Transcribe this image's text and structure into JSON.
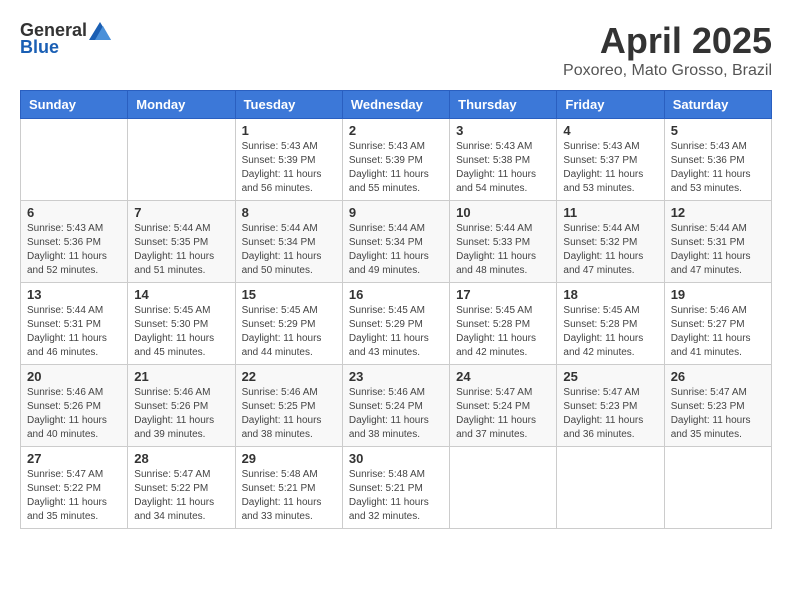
{
  "header": {
    "logo_general": "General",
    "logo_blue": "Blue",
    "title": "April 2025",
    "subtitle": "Poxoreo, Mato Grosso, Brazil"
  },
  "calendar": {
    "headers": [
      "Sunday",
      "Monday",
      "Tuesday",
      "Wednesday",
      "Thursday",
      "Friday",
      "Saturday"
    ],
    "weeks": [
      [
        {
          "day": "",
          "info": ""
        },
        {
          "day": "",
          "info": ""
        },
        {
          "day": "1",
          "info": "Sunrise: 5:43 AM\nSunset: 5:39 PM\nDaylight: 11 hours and 56 minutes."
        },
        {
          "day": "2",
          "info": "Sunrise: 5:43 AM\nSunset: 5:39 PM\nDaylight: 11 hours and 55 minutes."
        },
        {
          "day": "3",
          "info": "Sunrise: 5:43 AM\nSunset: 5:38 PM\nDaylight: 11 hours and 54 minutes."
        },
        {
          "day": "4",
          "info": "Sunrise: 5:43 AM\nSunset: 5:37 PM\nDaylight: 11 hours and 53 minutes."
        },
        {
          "day": "5",
          "info": "Sunrise: 5:43 AM\nSunset: 5:36 PM\nDaylight: 11 hours and 53 minutes."
        }
      ],
      [
        {
          "day": "6",
          "info": "Sunrise: 5:43 AM\nSunset: 5:36 PM\nDaylight: 11 hours and 52 minutes."
        },
        {
          "day": "7",
          "info": "Sunrise: 5:44 AM\nSunset: 5:35 PM\nDaylight: 11 hours and 51 minutes."
        },
        {
          "day": "8",
          "info": "Sunrise: 5:44 AM\nSunset: 5:34 PM\nDaylight: 11 hours and 50 minutes."
        },
        {
          "day": "9",
          "info": "Sunrise: 5:44 AM\nSunset: 5:34 PM\nDaylight: 11 hours and 49 minutes."
        },
        {
          "day": "10",
          "info": "Sunrise: 5:44 AM\nSunset: 5:33 PM\nDaylight: 11 hours and 48 minutes."
        },
        {
          "day": "11",
          "info": "Sunrise: 5:44 AM\nSunset: 5:32 PM\nDaylight: 11 hours and 47 minutes."
        },
        {
          "day": "12",
          "info": "Sunrise: 5:44 AM\nSunset: 5:31 PM\nDaylight: 11 hours and 47 minutes."
        }
      ],
      [
        {
          "day": "13",
          "info": "Sunrise: 5:44 AM\nSunset: 5:31 PM\nDaylight: 11 hours and 46 minutes."
        },
        {
          "day": "14",
          "info": "Sunrise: 5:45 AM\nSunset: 5:30 PM\nDaylight: 11 hours and 45 minutes."
        },
        {
          "day": "15",
          "info": "Sunrise: 5:45 AM\nSunset: 5:29 PM\nDaylight: 11 hours and 44 minutes."
        },
        {
          "day": "16",
          "info": "Sunrise: 5:45 AM\nSunset: 5:29 PM\nDaylight: 11 hours and 43 minutes."
        },
        {
          "day": "17",
          "info": "Sunrise: 5:45 AM\nSunset: 5:28 PM\nDaylight: 11 hours and 42 minutes."
        },
        {
          "day": "18",
          "info": "Sunrise: 5:45 AM\nSunset: 5:28 PM\nDaylight: 11 hours and 42 minutes."
        },
        {
          "day": "19",
          "info": "Sunrise: 5:46 AM\nSunset: 5:27 PM\nDaylight: 11 hours and 41 minutes."
        }
      ],
      [
        {
          "day": "20",
          "info": "Sunrise: 5:46 AM\nSunset: 5:26 PM\nDaylight: 11 hours and 40 minutes."
        },
        {
          "day": "21",
          "info": "Sunrise: 5:46 AM\nSunset: 5:26 PM\nDaylight: 11 hours and 39 minutes."
        },
        {
          "day": "22",
          "info": "Sunrise: 5:46 AM\nSunset: 5:25 PM\nDaylight: 11 hours and 38 minutes."
        },
        {
          "day": "23",
          "info": "Sunrise: 5:46 AM\nSunset: 5:24 PM\nDaylight: 11 hours and 38 minutes."
        },
        {
          "day": "24",
          "info": "Sunrise: 5:47 AM\nSunset: 5:24 PM\nDaylight: 11 hours and 37 minutes."
        },
        {
          "day": "25",
          "info": "Sunrise: 5:47 AM\nSunset: 5:23 PM\nDaylight: 11 hours and 36 minutes."
        },
        {
          "day": "26",
          "info": "Sunrise: 5:47 AM\nSunset: 5:23 PM\nDaylight: 11 hours and 35 minutes."
        }
      ],
      [
        {
          "day": "27",
          "info": "Sunrise: 5:47 AM\nSunset: 5:22 PM\nDaylight: 11 hours and 35 minutes."
        },
        {
          "day": "28",
          "info": "Sunrise: 5:47 AM\nSunset: 5:22 PM\nDaylight: 11 hours and 34 minutes."
        },
        {
          "day": "29",
          "info": "Sunrise: 5:48 AM\nSunset: 5:21 PM\nDaylight: 11 hours and 33 minutes."
        },
        {
          "day": "30",
          "info": "Sunrise: 5:48 AM\nSunset: 5:21 PM\nDaylight: 11 hours and 32 minutes."
        },
        {
          "day": "",
          "info": ""
        },
        {
          "day": "",
          "info": ""
        },
        {
          "day": "",
          "info": ""
        }
      ]
    ]
  }
}
